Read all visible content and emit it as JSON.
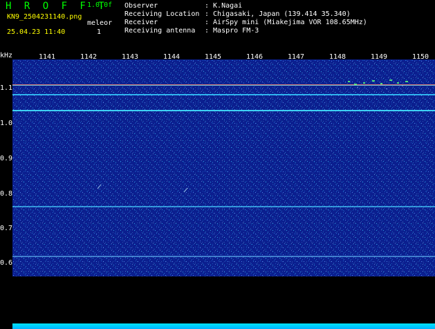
{
  "header": {
    "app_title": "H R O F F T",
    "version": "1.0.0f",
    "filename": "KN9_2504231140.png",
    "timestamp": "25.04.23 11:40",
    "mode_label": "meleor",
    "mode_value": "1",
    "info": [
      {
        "label": "Observer",
        "value": ": K.Nagai"
      },
      {
        "label": "Receiving Location",
        "value": ": Chigasaki, Japan (139.414 35.340)"
      },
      {
        "label": "Receiver",
        "value": ": AirSpy mini (Miakejima VOR 108.65MHz)"
      },
      {
        "label": "Receiving antenna",
        "value": ": Maspro FM-3"
      }
    ]
  },
  "spectrogram": {
    "y_unit": "kHz",
    "y_ticks": [
      "1.1",
      "1.0",
      "0.9",
      "0.8",
      "0.7",
      "0.6"
    ],
    "x_ticks": [
      "1141",
      "1142",
      "1143",
      "1144",
      "1145",
      "1146",
      "1147",
      "1148",
      "1149",
      "1150"
    ],
    "colors": {
      "background": "#0b1f8f",
      "signal_red": "#ff3b3b",
      "signal_cyan": "#44e5ff",
      "signal_green": "#5bff7a",
      "baseline": "#00e6ff"
    }
  }
}
